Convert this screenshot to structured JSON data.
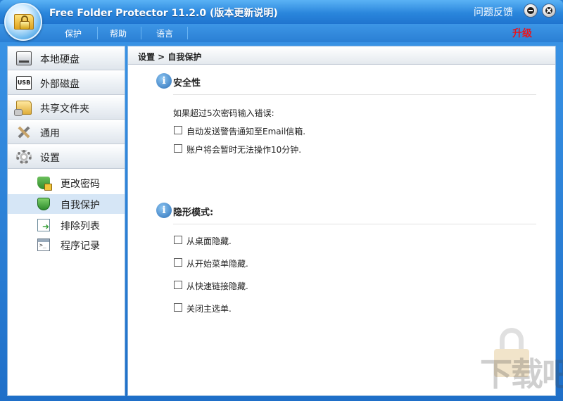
{
  "window": {
    "title": "Free Folder Protector 11.2.0 (版本更新说明)",
    "feedback_label": "问题反馈",
    "minimize_icon": "minimize-icon",
    "close_icon": "close-icon"
  },
  "menu": {
    "items": [
      "保护",
      "帮助",
      "语言"
    ],
    "upgrade_label": "升级",
    "upgrade_color": "#e8141c"
  },
  "sidebar": {
    "items": [
      {
        "label": "本地硬盘",
        "icon": "hard-disk-icon"
      },
      {
        "label": "外部磁盘",
        "icon": "usb-icon"
      },
      {
        "label": "共享文件夹",
        "icon": "shared-folder-icon"
      },
      {
        "label": "通用",
        "icon": "tools-icon"
      },
      {
        "label": "设置",
        "icon": "gear-icon"
      }
    ],
    "sub_items": [
      {
        "label": "更改密码",
        "icon": "shield-lock-icon",
        "active": false
      },
      {
        "label": "自我保护",
        "icon": "shield-icon",
        "active": true
      },
      {
        "label": "排除列表",
        "icon": "exclude-list-icon",
        "active": false
      },
      {
        "label": "程序记录",
        "icon": "console-icon",
        "active": false
      }
    ]
  },
  "main": {
    "breadcrumb": "设置 > 自我保护",
    "security": {
      "title": "安全性",
      "prompt": "如果超过5次密码输入错误:",
      "options": [
        {
          "label": "自动发送警告通知至Email信箱.",
          "checked": false
        },
        {
          "label": "账户将会暂时无法操作10分钟.",
          "checked": false
        }
      ]
    },
    "stealth": {
      "title": "隐形模式:",
      "options": [
        {
          "label": "从桌面隐藏.",
          "checked": false
        },
        {
          "label": "从开始菜单隐藏.",
          "checked": false
        },
        {
          "label": "从快速链接隐藏.",
          "checked": false
        },
        {
          "label": "关闭主选单.",
          "checked": false
        }
      ]
    }
  },
  "watermark": {
    "text": "下载吧"
  }
}
